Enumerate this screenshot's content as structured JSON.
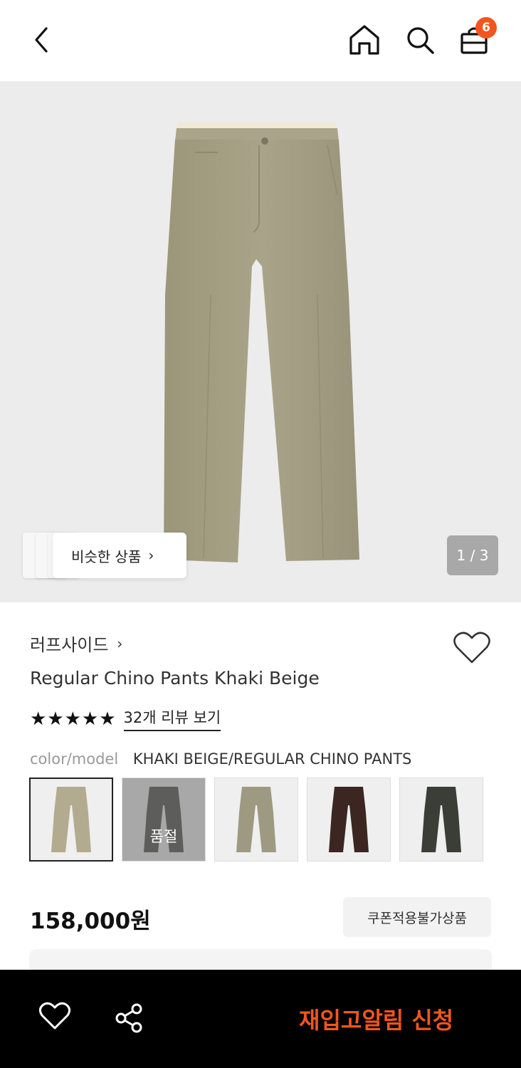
{
  "header": {
    "cart_count": "6",
    "icons": [
      "back-arrow-icon",
      "home-icon",
      "search-icon",
      "shopping-bag-icon"
    ]
  },
  "hero": {
    "similar_label": "비슷한 상품",
    "pager": "1 / 3",
    "product_color": "#a39e84"
  },
  "product": {
    "brand": "러프사이드",
    "title": "Regular Chino Pants Khaki Beige",
    "stars": "★★★★★",
    "reviews_label": "32개 리뷰 보기",
    "color_model_key": "color/model",
    "color_model_value": "KHAKI BEIGE/REGULAR CHINO PANTS",
    "price": "158,000원",
    "coupon_label": "쿠폰적용불가상품"
  },
  "swatches": [
    {
      "color": "#b3ab8f",
      "selected": true,
      "sold_out": false
    },
    {
      "color": "#4a4a48",
      "selected": false,
      "sold_out": true,
      "sold_label": "품절"
    },
    {
      "color": "#9e9a82",
      "selected": false,
      "sold_out": false
    },
    {
      "color": "#3b2621",
      "selected": false,
      "sold_out": false
    },
    {
      "color": "#3b3d37",
      "selected": false,
      "sold_out": false
    }
  ],
  "bottom": {
    "restock_label": "재입고알림 신청",
    "accent_color": "#f2561d"
  }
}
